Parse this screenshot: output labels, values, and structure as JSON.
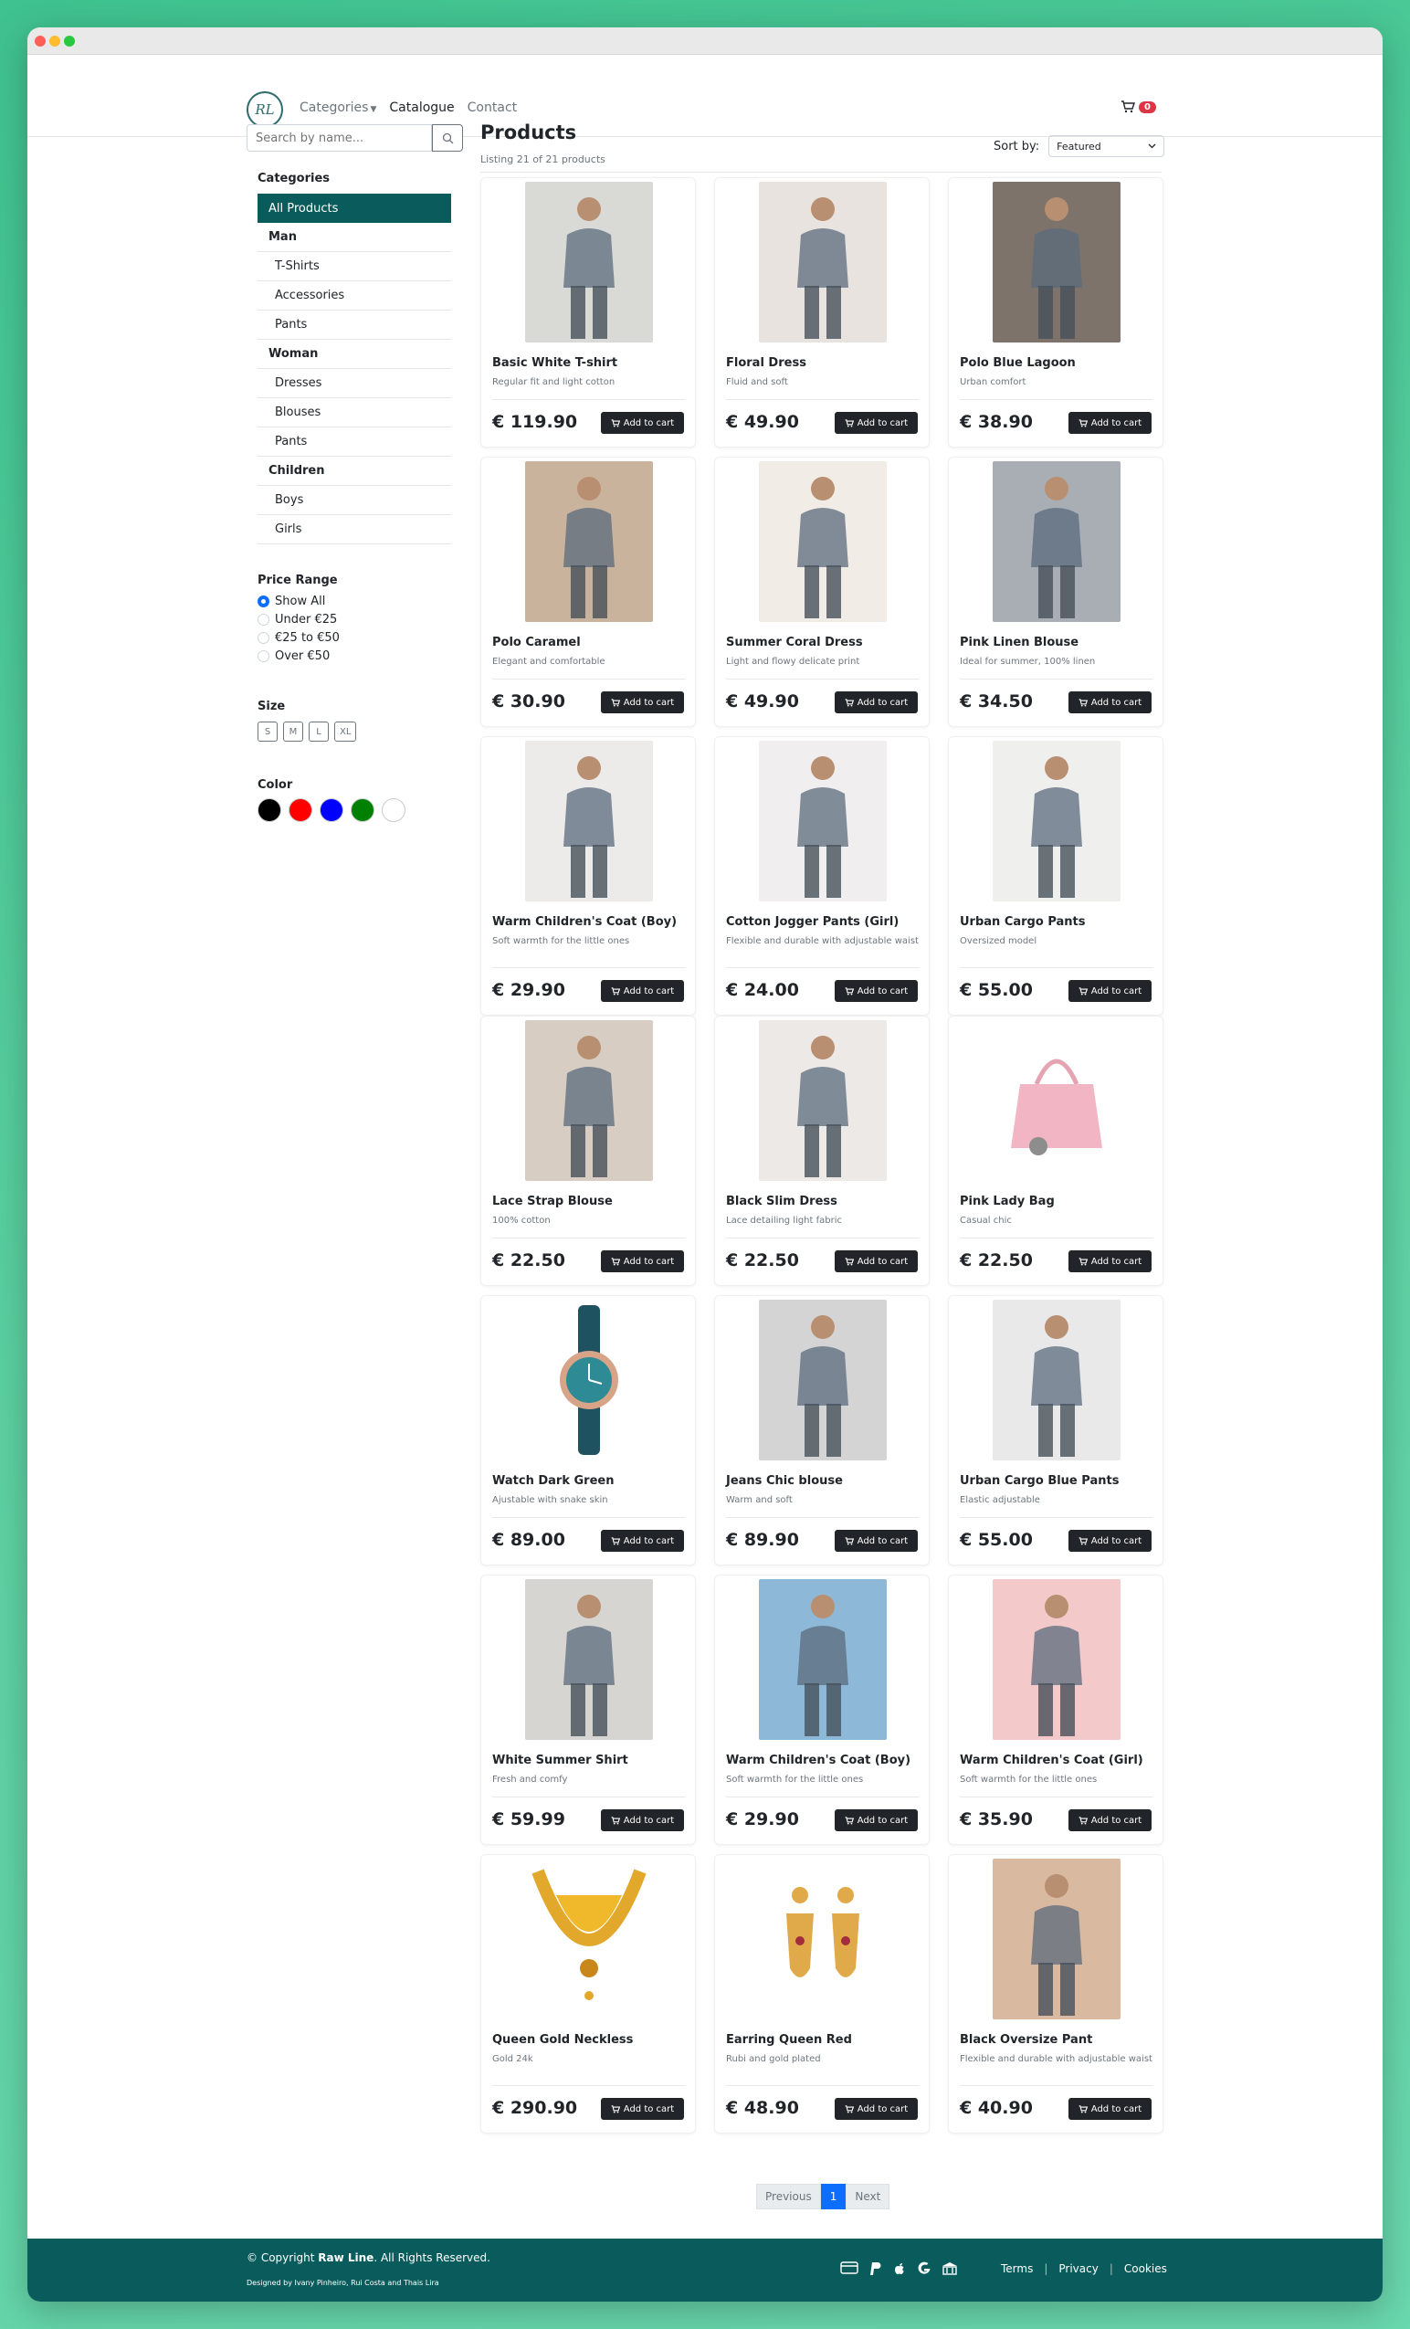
{
  "nav": {
    "logo": "RL",
    "categories": "Categories",
    "catalogue": "Catalogue",
    "contact": "Contact",
    "cart_count": "0"
  },
  "sidebar": {
    "search_placeholder": "Search by name...",
    "categories_title": "Categories",
    "categories": [
      {
        "label": "All Products",
        "kind": "active"
      },
      {
        "label": "Man",
        "kind": "group"
      },
      {
        "label": "T-Shirts",
        "kind": "sub"
      },
      {
        "label": "Accessories",
        "kind": "sub"
      },
      {
        "label": "Pants",
        "kind": "sub"
      },
      {
        "label": "Woman",
        "kind": "group"
      },
      {
        "label": "Dresses",
        "kind": "sub"
      },
      {
        "label": "Blouses",
        "kind": "sub"
      },
      {
        "label": "Pants",
        "kind": "sub"
      },
      {
        "label": "Children",
        "kind": "group"
      },
      {
        "label": "Boys",
        "kind": "sub"
      },
      {
        "label": "Girls",
        "kind": "sub"
      }
    ],
    "price_title": "Price Range",
    "price_options": [
      {
        "label": "Show All",
        "checked": true
      },
      {
        "label": "Under €25",
        "checked": false
      },
      {
        "label": "€25 to €50",
        "checked": false
      },
      {
        "label": "Over €50",
        "checked": false
      }
    ],
    "size_title": "Size",
    "sizes": [
      "S",
      "M",
      "L",
      "XL"
    ],
    "color_title": "Color",
    "colors": [
      "#000000",
      "#ff0000",
      "#0000ff",
      "#008000",
      "#ffffff"
    ]
  },
  "main": {
    "title": "Products",
    "listing": "Listing 21 of 21 products",
    "sort_label": "Sort by:",
    "sort_value": "Featured",
    "add_label": "Add to cart",
    "products": [
      {
        "name": "Basic White T-shirt",
        "desc": "Regular fit and light cotton",
        "price": "€ 119.90",
        "img": "person",
        "tone": "#d9d9d6"
      },
      {
        "name": "Floral Dress",
        "desc": "Fluid and soft",
        "price": "€ 49.90",
        "img": "person",
        "tone": "#e8e3de"
      },
      {
        "name": "Polo Blue Lagoon",
        "desc": "Urban comfort",
        "price": "€ 38.90",
        "img": "person",
        "tone": "#7d736a"
      },
      {
        "name": "Polo Caramel",
        "desc": "Elegant and comfortable",
        "price": "€ 30.90",
        "img": "person",
        "tone": "#c9b39c"
      },
      {
        "name": "Summer Coral Dress",
        "desc": "Light and flowy delicate print",
        "price": "€ 49.90",
        "img": "person",
        "tone": "#f2ece6"
      },
      {
        "name": "Pink Linen Blouse",
        "desc": "Ideal for summer, 100% linen",
        "price": "€ 34.50",
        "img": "person",
        "tone": "#a9adb4"
      },
      {
        "name": "Warm Children's Coat (Boy)",
        "desc": "Soft warmth for the little ones",
        "price": "€ 29.90",
        "img": "person",
        "tone": "#ecebea"
      },
      {
        "name": "Cotton Jogger Pants (Girl)",
        "desc": "Flexible and durable with adjustable waist",
        "price": "€ 24.00",
        "img": "person",
        "tone": "#f1eef0"
      },
      {
        "name": "Urban Cargo Pants",
        "desc": "Oversized model",
        "price": "€ 55.00",
        "img": "person",
        "tone": "#efefee"
      },
      {
        "name": "Lace Strap Blouse",
        "desc": "100% cotton",
        "price": "€ 22.50",
        "img": "person",
        "tone": "#d8cdc2"
      },
      {
        "name": "Black Slim Dress",
        "desc": "Lace detailing light fabric",
        "price": "€ 22.50",
        "img": "person",
        "tone": "#ece9e6"
      },
      {
        "name": "Pink Lady Bag",
        "desc": "Casual chic",
        "price": "€ 22.50",
        "img": "bag",
        "tone": "#ffffff"
      },
      {
        "name": "Watch Dark Green",
        "desc": "Ajustable with snake skin",
        "price": "€ 89.00",
        "img": "watch",
        "tone": "#ffffff"
      },
      {
        "name": "Jeans Chic blouse",
        "desc": "Warm and soft",
        "price": "€ 89.90",
        "img": "person",
        "tone": "#d4d4d4"
      },
      {
        "name": "Urban Cargo Blue Pants",
        "desc": "Elastic adjustable",
        "price": "€ 55.00",
        "img": "person",
        "tone": "#e9e9e9"
      },
      {
        "name": "White Summer Shirt",
        "desc": "Fresh and comfy",
        "price": "€ 59.99",
        "img": "person",
        "tone": "#d7d5d2"
      },
      {
        "name": "Warm Children's Coat (Boy)",
        "desc": "Soft warmth for the little ones",
        "price": "€ 29.90",
        "img": "person",
        "tone": "#8db8d8"
      },
      {
        "name": "Warm Children's Coat (Girl)",
        "desc": "Soft warmth for the little ones",
        "price": "€ 35.90",
        "img": "person",
        "tone": "#f3c9c9"
      },
      {
        "name": "Queen Gold Neckless",
        "desc": "Gold 24k",
        "price": "€ 290.90",
        "img": "necklace",
        "tone": "#ffffff"
      },
      {
        "name": "Earring Queen Red",
        "desc": "Rubi and gold plated",
        "price": "€ 48.90",
        "img": "earring",
        "tone": "#ffffff"
      },
      {
        "name": "Black Oversize Pant",
        "desc": "Flexible and durable with adjustable waist",
        "price": "€ 40.90",
        "img": "person",
        "tone": "#d9b9a0"
      }
    ]
  },
  "pagination": {
    "previous": "Previous",
    "current": "1",
    "next": "Next"
  },
  "footer": {
    "copyright_prefix": "© Copyright ",
    "brand": "Raw Line",
    "copyright_suffix": ". All Rights Reserved.",
    "designed": "Designed by Ivany Pinheiro, Rui Costa and Thais Lira",
    "payment_icons": [
      "credit-card-icon",
      "paypal-icon",
      "apple-icon",
      "google-icon",
      "bank-icon"
    ],
    "links": [
      "Terms",
      "Privacy",
      "Cookies"
    ]
  }
}
